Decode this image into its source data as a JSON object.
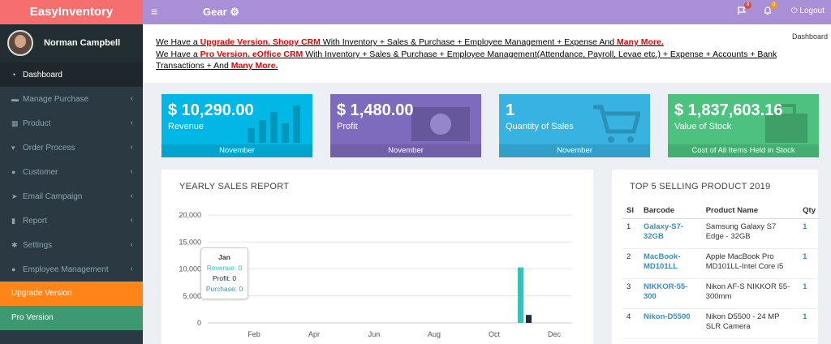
{
  "app": {
    "logo": "EasyInventory",
    "brand": "Gear ⚙"
  },
  "topbar": {
    "menu_icon": "≡",
    "messages_count": "8",
    "alerts_count": "0",
    "logout_label": "Logout"
  },
  "colors": {
    "logo_bg": "#f56f6f",
    "topbar_bg": "#a98fd6",
    "sidebar_bg": "#2b3a42",
    "badge_red": "#dd4b39",
    "badge_yellow": "#f39c12"
  },
  "user": {
    "name": "Norman Campbell"
  },
  "sidebar": {
    "items": [
      {
        "label": "Dashboard",
        "icon": "dashboard-icon"
      },
      {
        "label": "Manage Purchase",
        "icon": "briefcase-icon"
      },
      {
        "label": "Product",
        "icon": "grid-icon"
      },
      {
        "label": "Order Process",
        "icon": "cart-icon"
      },
      {
        "label": "Customer",
        "icon": "user-icon"
      },
      {
        "label": "Email Campaign",
        "icon": "send-icon"
      },
      {
        "label": "Report",
        "icon": "bar-chart-icon"
      },
      {
        "label": "Settings",
        "icon": "cogs-icon"
      },
      {
        "label": "Employee Management",
        "icon": "users-icon"
      }
    ],
    "upgrade_label": "Upgrade Version",
    "pro_label": "Pro Version"
  },
  "notice": {
    "line1": {
      "a": "We Have a ",
      "b": "Upgrade Version. Shopy CRM",
      "c": " With Inventory + Sales & Purchase + Employee Management + Expense And ",
      "d": "Many More."
    },
    "line2": {
      "a": "We Have a ",
      "b": "Pro Version. eOffice CRM",
      "c": " With Inventory + Sales & Purchase + Employee Management(Attendance, Payroll, Levae etc.) + Expense + Accounts + Bank Transactions + And ",
      "d": "Many More."
    },
    "breadcrumb": "Dashboard"
  },
  "stats": [
    {
      "value": "$ 10,290.00",
      "label": "Revenue",
      "footer": "November",
      "color": "#00b7e6"
    },
    {
      "value": "$ 1,480.00",
      "label": "Profit",
      "footer": "November",
      "color": "#7e6bbd"
    },
    {
      "value": "1",
      "label": "Quantity of Sales",
      "footer": "November",
      "color": "#37b2e1"
    },
    {
      "value": "$ 1,837,603.16",
      "label": "Value of Stock",
      "footer": "Cost of All Items Held in Stock",
      "color": "#4cc27e"
    }
  ],
  "yearly": {
    "title": "YEARLY SALES REPORT",
    "tooltip": {
      "month": "Jan",
      "revenue": "Revenue: 0",
      "profit": "Profit: 0",
      "purchase": "Purchase: 0"
    }
  },
  "chart_data": {
    "type": "bar",
    "categories": [
      "Jan",
      "Feb",
      "Mar",
      "Apr",
      "May",
      "Jun",
      "Jul",
      "Aug",
      "Sep",
      "Oct",
      "Nov",
      "Dec"
    ],
    "series": [
      {
        "name": "Revenue",
        "values": [
          0,
          0,
          0,
          0,
          0,
          0,
          0,
          0,
          0,
          0,
          10290,
          0
        ],
        "color": "#39c0b8"
      },
      {
        "name": "Profit",
        "values": [
          0,
          0,
          0,
          0,
          0,
          0,
          0,
          0,
          0,
          0,
          1480,
          0
        ],
        "color": "#1f2d3a"
      },
      {
        "name": "Purchase",
        "values": [
          0,
          0,
          0,
          0,
          0,
          0,
          0,
          0,
          0,
          0,
          0,
          0
        ],
        "color": "#3c8dbc"
      }
    ],
    "x_tick_labels": [
      "Feb",
      "Apr",
      "Jun",
      "Aug",
      "Oct",
      "Dec"
    ],
    "y_ticks": [
      "0",
      "5,000",
      "10,000",
      "15,000",
      "20,000"
    ],
    "ylim": [
      0,
      20000
    ],
    "grid": true
  },
  "top5": {
    "title": "TOP 5 SELLING PRODUCT 2019",
    "headers": [
      "Sl",
      "Barcode",
      "Product Name",
      "Qty"
    ],
    "rows": [
      {
        "sl": "1",
        "barcode": "Galaxy-S7-32GB",
        "name": "Samsung Galaxy S7 Edge - 32GB",
        "qty": "1"
      },
      {
        "sl": "2",
        "barcode": "MacBook-MD101LL",
        "name": "Apple MacBook Pro MD101LL-Intel Core i5",
        "qty": "1"
      },
      {
        "sl": "3",
        "barcode": "NIKKOR-55-300",
        "name": "Nikon AF-S NIKKOR 55-300mm",
        "qty": "1"
      },
      {
        "sl": "4",
        "barcode": "Nikon-D5500",
        "name": "Nikon D5500 - 24 MP SLR Camera",
        "qty": "1"
      }
    ]
  }
}
